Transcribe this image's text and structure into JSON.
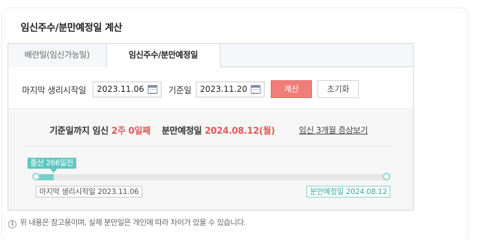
{
  "title": "임신주수/분만예정일 계산",
  "tabs": [
    {
      "label": "배란일(임신가능일)",
      "active": false
    },
    {
      "label": "임신주수/분만예정일",
      "active": true
    }
  ],
  "form": {
    "start_label": "마지막 생리시작일",
    "start_value": "2023.11.06",
    "base_label": "기준일",
    "base_value": "2023.11.20",
    "calc_button": "계산",
    "reset_button": "초기화"
  },
  "result": {
    "prefix": "기준일까지 임신",
    "weeks": "2주 0일째",
    "due_label": "분만예정일",
    "due_date": "2024.08.12(월)",
    "symptom_link": "임신 3개월 증상보기"
  },
  "timeline": {
    "badge": "출산 266일전",
    "progress": 0.05,
    "start_label": "마지막 생리시작일 2023.11.06",
    "end_label": "분만예정일 2024.08.12"
  },
  "notice": {
    "icon": "info-icon",
    "text": "위 내용은 참고용이며, 실제 분만일은 개인에 따라 차이가 있을 수 있습니다."
  },
  "colors": {
    "accent_red": "#e05a57",
    "calc_button": "#f07d7a",
    "teal": "#5fc8c0"
  }
}
